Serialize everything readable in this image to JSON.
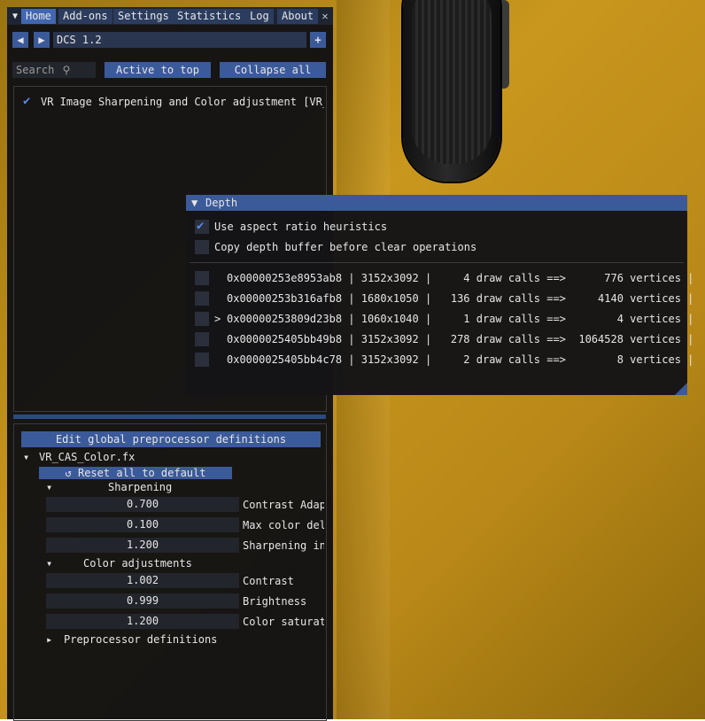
{
  "tabs": [
    {
      "label": "Home"
    },
    {
      "label": "Add-ons"
    },
    {
      "label": "Settings"
    },
    {
      "label": "Statistics"
    },
    {
      "label": "Log"
    },
    {
      "label": "About"
    }
  ],
  "preset": {
    "name": "DCS 1.2",
    "prev_icon": "triangle-left-icon",
    "next_icon": "triangle-right-icon",
    "add_icon": "plus-icon"
  },
  "search": {
    "placeholder": "Search",
    "icon": "search-icon"
  },
  "toolbar": {
    "active_to_top": "Active to top",
    "collapse_all": "Collapse all"
  },
  "effects": [
    {
      "label": "VR Image Sharpening and Color adjustment [VR_C",
      "checked": true
    }
  ],
  "settings": {
    "edit_global": "Edit global preprocessor definitions",
    "file": "VR_CAS_Color.fx",
    "reset": "Reset all to default",
    "groups": [
      {
        "title": "Sharpening",
        "items": [
          {
            "value": "0.700",
            "label": "Contrast Adapt"
          },
          {
            "value": "0.100",
            "label": "Max color delt"
          },
          {
            "value": "1.200",
            "label": "Sharpening int"
          }
        ]
      },
      {
        "title": "Color adjustments",
        "items": [
          {
            "value": "1.002",
            "label": "Contrast"
          },
          {
            "value": "0.999",
            "label": "Brightness"
          },
          {
            "value": "1.200",
            "label": "Color saturati"
          }
        ]
      }
    ],
    "preproc": "Preprocessor definitions"
  },
  "depth": {
    "title": "Depth",
    "opt1": "Use aspect ratio heuristics",
    "opt1_checked": true,
    "opt2": "Copy depth buffer before clear operations",
    "opt2_checked": false,
    "rows": [
      {
        "marker": " ",
        "text": "0x00000253e8953ab8 | 3152x3092 |     4 draw calls ==>      776 vertices |"
      },
      {
        "marker": " ",
        "text": "0x00000253b316afb8 | 1680x1050 |   136 draw calls ==>     4140 vertices |"
      },
      {
        "marker": ">",
        "text": "0x00000253809d23b8 | 1060x1040 |     1 draw calls ==>        4 vertices |"
      },
      {
        "marker": " ",
        "text": "0x0000025405bb49b8 | 3152x3092 |   278 draw calls ==>  1064528 vertices |"
      },
      {
        "marker": " ",
        "text": "0x0000025405bb4c78 | 3152x3092 |     2 draw calls ==>        8 vertices |"
      }
    ]
  },
  "colors": {
    "accent": "#4267b0",
    "button": "#3b5a9a",
    "panel": "#121214",
    "background": "#c9971d"
  }
}
